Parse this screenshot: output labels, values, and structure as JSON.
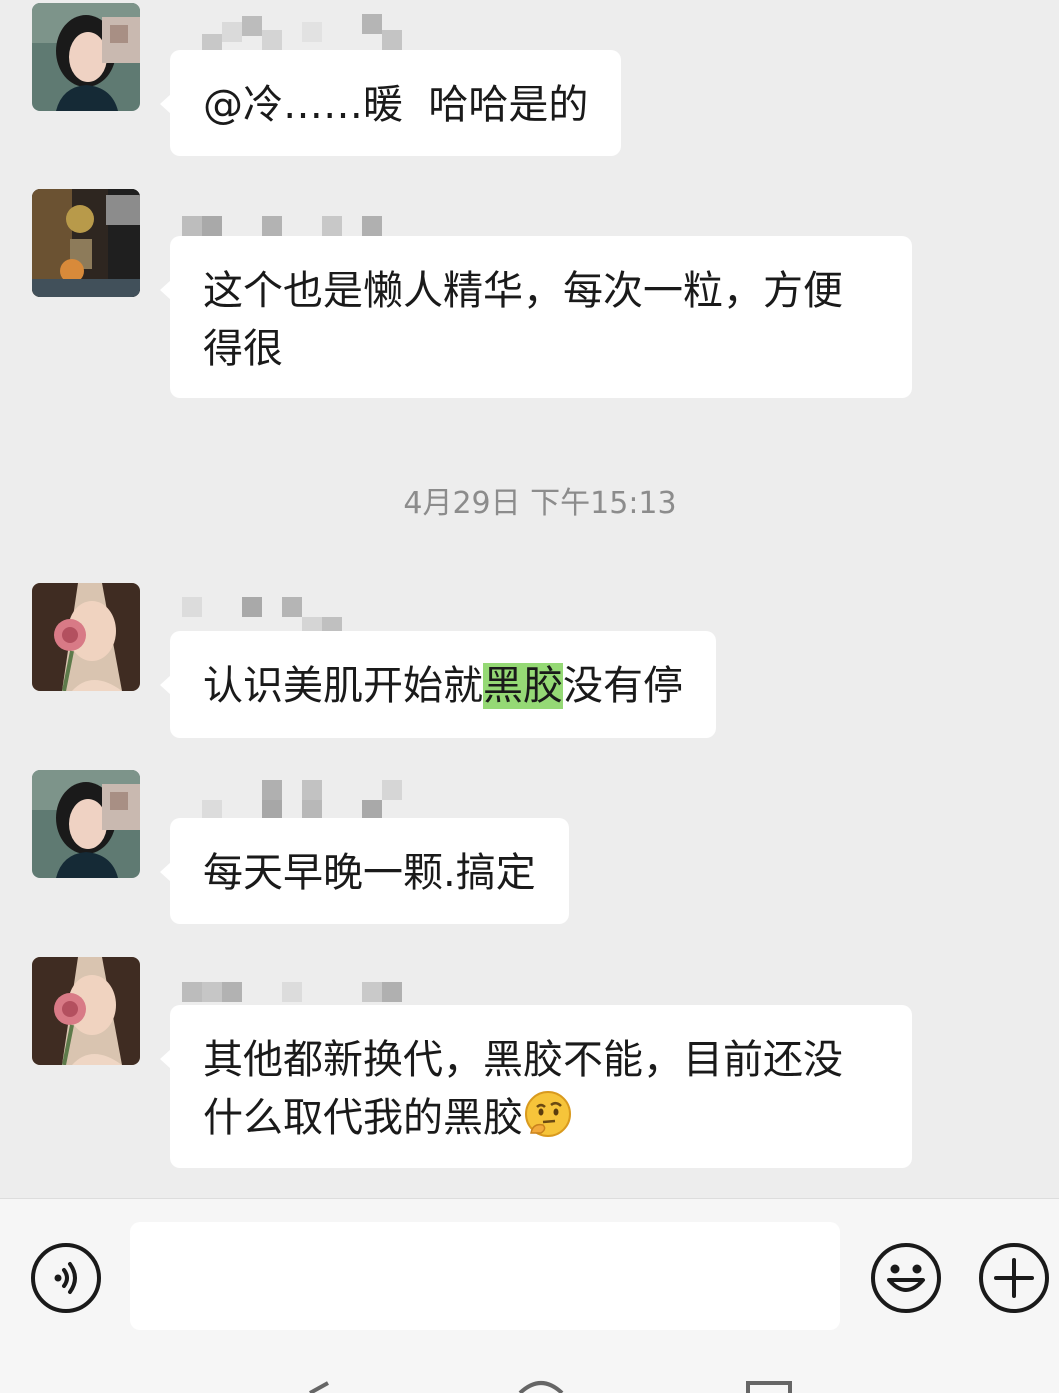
{
  "messages": [
    {
      "id": 1,
      "avatar": "short-hair-woman-avatar",
      "text": "@冷……暖  哈哈是的"
    },
    {
      "id": 2,
      "avatar": "flower-vase-avatar",
      "text": "这个也是懒人精华，每次一粒，方便得很"
    },
    {
      "id": 3,
      "avatar": "rose-woman-avatar",
      "text_before": "认识美肌开始就",
      "highlight": "黑胶",
      "text_after": "没有停"
    },
    {
      "id": 4,
      "avatar": "short-hair-woman-avatar",
      "text": "每天早晚一颗.搞定"
    },
    {
      "id": 5,
      "avatar": "rose-woman-avatar",
      "text": "其他都新换代，黑胶不能，目前还没什么取代我的黑胶",
      "emoji": "thinking-face-emoji"
    }
  ],
  "timestamp": "4月29日 下午15:13",
  "input": {
    "value": "",
    "icons": {
      "voice": "voice-icon",
      "emoji": "smiley-icon",
      "more": "plus-icon"
    }
  },
  "colors": {
    "background": "#ededed",
    "bubble": "#ffffff",
    "highlight": "#95d975",
    "timestamp": "#8c8c8c"
  }
}
